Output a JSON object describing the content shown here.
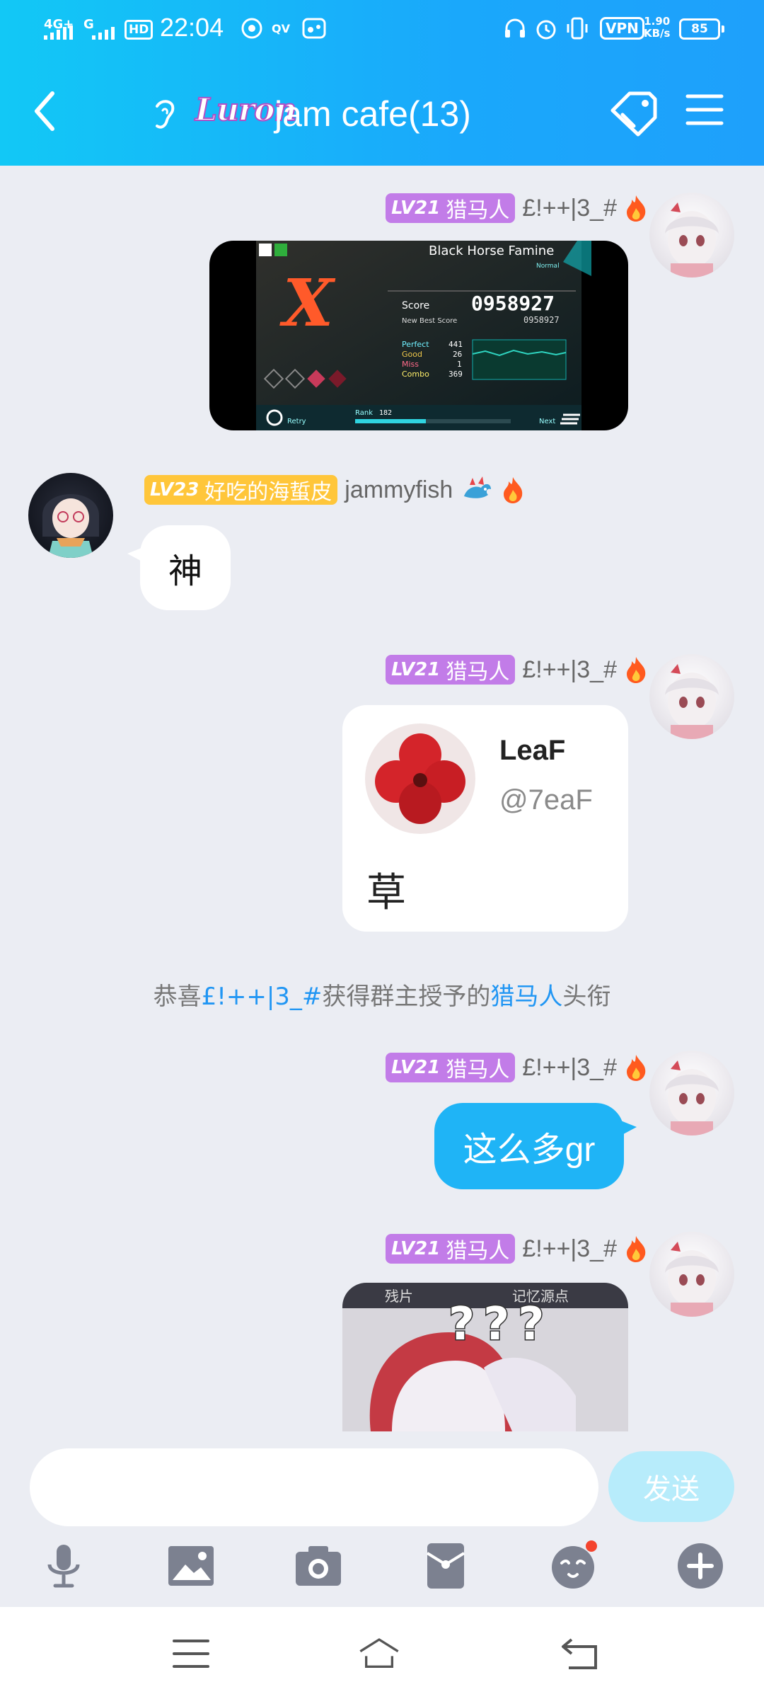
{
  "status_bar": {
    "network_1": "4G+",
    "network_2": "G",
    "hd": "HD",
    "time": "22:04",
    "vpn": "VPN",
    "speed_value": "1.90",
    "speed_unit": "KB/s",
    "battery": "85"
  },
  "header": {
    "logo_text": "Luron",
    "title": "jam cafe(13)"
  },
  "messages": [
    {
      "sender": "me",
      "level": "LV21",
      "title_badge": "猎马人",
      "username": "£!++|3_#",
      "kind": "image",
      "image": {
        "song": "Black Horse Famine",
        "difficulty": "Normal",
        "grade": "X",
        "score_label": "Score",
        "score": "0958927",
        "best_label": "New Best Score",
        "best": "0958927",
        "perfect_label": "Perfect",
        "perfect": "441",
        "good_label": "Good",
        "good": "26",
        "miss_label": "Miss",
        "miss": "1",
        "combo_label": "Combo",
        "combo": "369",
        "retry": "Retry",
        "rank_label": "Rank",
        "rank": "182",
        "next": "Next"
      }
    },
    {
      "sender": "other",
      "level": "LV23",
      "title_badge": "好吃的海蜇皮",
      "username": "jammyfish",
      "kind": "text",
      "text": "神"
    },
    {
      "sender": "me",
      "level": "LV21",
      "title_badge": "猎马人",
      "username": "£!++|3_#",
      "kind": "share",
      "share": {
        "name": "LeaF",
        "handle": "@7eaF",
        "text": "草"
      }
    },
    {
      "sender": "me",
      "level": "LV21",
      "title_badge": "猎马人",
      "username": "£!++|3_#",
      "kind": "text",
      "text": "这么多gr"
    },
    {
      "sender": "me",
      "level": "LV21",
      "title_badge": "猎马人",
      "username": "£!++|3_#",
      "kind": "image",
      "image2": {
        "left_text": "残片",
        "right_text": "记忆源点",
        "marks": "???"
      }
    }
  ],
  "system_message": {
    "prefix": "恭喜",
    "user": "£!++|3_#",
    "middle": "获得群主授予的",
    "title": "猎马人",
    "suffix": "头衔"
  },
  "input": {
    "placeholder": "",
    "send_label": "发送"
  },
  "colors": {
    "header_start": "#12c8f6",
    "header_end": "#1ea0fb",
    "bubble_blue": "#1fb4f6",
    "level_purple": "#c27ce8",
    "level_yellow": "#ffc63a",
    "send_disabled": "#b7ecfb"
  },
  "icons": {
    "back": "chevron-left-icon",
    "ear": "ear-icon",
    "tag": "tag-icon",
    "menu": "menu-icon",
    "tools": [
      "microphone-icon",
      "image-icon",
      "camera-icon",
      "red-packet-icon",
      "emoji-icon",
      "plus-icon"
    ],
    "nav": [
      "recents-icon",
      "home-icon",
      "back-icon"
    ]
  }
}
